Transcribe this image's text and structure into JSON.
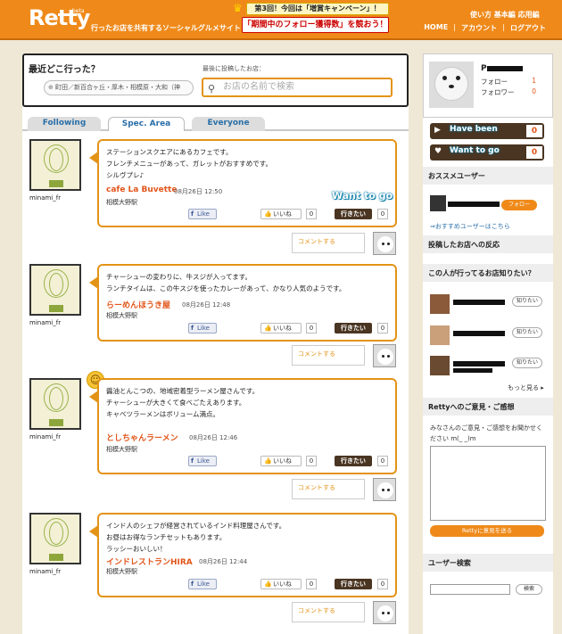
{
  "header": {
    "logo": "Retty",
    "beta": "beta",
    "tagline": "行ったお店を共有するソーシャルグルメサイト",
    "campaign_top": "第3回！今回は「増賞キャンペーン」！",
    "campaign_bottom": "「期間中のフォロー獲得数」を競おう！",
    "guide": "使い方 基本編 応用編",
    "nav": [
      "HOME",
      "アカウント",
      "ログアウト"
    ]
  },
  "search": {
    "title": "最近どこ行った？",
    "area": "町田／新百合ヶ丘・厚木・相模原・大和（神",
    "label": "最後に投稿したお店：",
    "placeholder": "お店の名前で検索"
  },
  "tabs": [
    "Following",
    "Spec. Area",
    "Everyone"
  ],
  "posts": [
    {
      "username": "minami_fr",
      "text": "ステーションスクエアにあるカフェです。\nフレンチメニューがあって、ガレットがおすすめです。\nシルヴプレ♪",
      "shop": "cafe La Buvette",
      "date": "08月26日 12:50",
      "station": "相模大野駅",
      "like": "Like",
      "iine": "いいね",
      "iine_count": "0",
      "goto": "行きたい",
      "goto_count": "0",
      "want_label": "Want to go",
      "comment": "コメントする"
    },
    {
      "username": "minami_fr",
      "text": "チャーシューの変わりに、牛スジが入ってます。\nランチタイムは、この牛スジを使ったカレーがあって、かなり人気のようです。",
      "shop": "らーめんほうき屋",
      "date": "08月26日 12:48",
      "station": "相模大野駅",
      "like": "Like",
      "iine": "いいね",
      "iine_count": "0",
      "goto": "行きたい",
      "goto_count": "0",
      "comment": "コメントする"
    },
    {
      "username": "minami_fr",
      "text": "醤油とんこつの、地域密着型ラーメン屋さんです。\nチャーシューが大きくて食べごたえあります。\nキャベツラーメンはボリューム満点。",
      "shop": "としちゃんラーメン",
      "date": "08月26日 12:46",
      "station": "相模大野駅",
      "like": "Like",
      "iine": "いいね",
      "iine_count": "0",
      "goto": "行きたい",
      "goto_count": "0",
      "comment": "コメントする"
    },
    {
      "username": "minami_fr",
      "text": "インド人のシェフが経営されているインド料理屋さんです。\nお昼はお得なランチセットもあります。\nラッシーおいしい！",
      "shop": "インドレストランHIRA",
      "date": "08月26日 12:44",
      "station": "相模大野駅",
      "like": "Like",
      "iine": "いいね",
      "iine_count": "0",
      "goto": "行きたい",
      "goto_count": "0",
      "comment": "コメントする"
    }
  ],
  "sidebar": {
    "profile_name": "P",
    "follow_label": "フォロー",
    "follow_count": "1",
    "follower_label": "フォロワー",
    "follower_count": "0",
    "have_been": "Have been",
    "have_been_count": "0",
    "want_to_go": "Want to go",
    "want_to_go_count": "0",
    "recommend_heading": "おススメユーザー",
    "follow_button": "フォロー",
    "recommend_link": "⇒おすすめユーザーはこちら",
    "reaction_heading": "投稿したお店への反応",
    "know_heading": "この人が行ってるお店知りたい？",
    "know_button": "知りたい",
    "more": "もっと見る",
    "opinion_heading": "Rettyへのご意見・ご感想",
    "opinion_text": "みなさんのご意見・ご感想をお聞かせください m(_ _)m",
    "send_button": "Rettyに意見を送る",
    "user_search_heading": "ユーザー検索",
    "user_search_button": "検索"
  }
}
